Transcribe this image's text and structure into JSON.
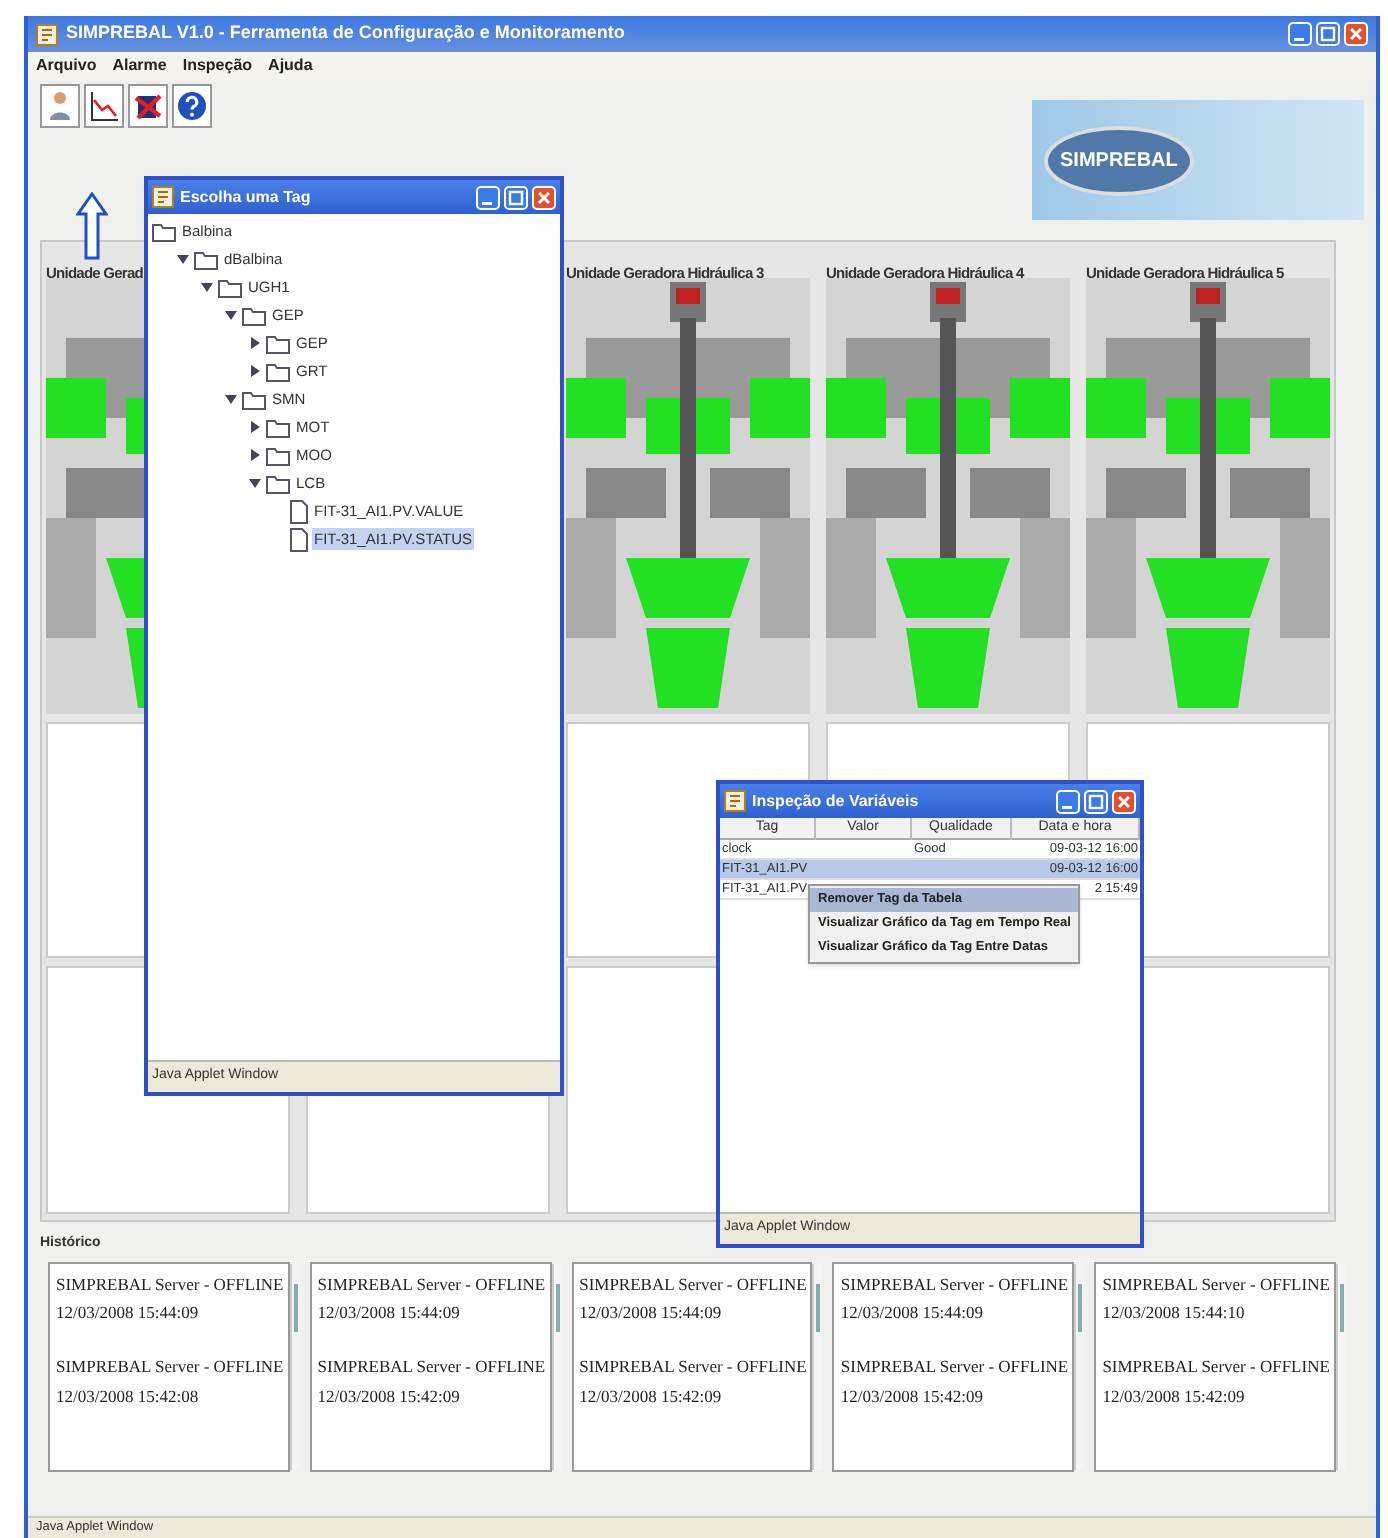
{
  "window": {
    "title": "SIMPREBAL V1.0 - Ferramenta de Configuração e Monitoramento"
  },
  "menu": [
    "Arquivo",
    "Alarme",
    "Inspeção",
    "Ajuda"
  ],
  "logo": {
    "text": "SIMPREBAL"
  },
  "units": [
    {
      "kind": "unit",
      "header": "Unidade Gerad"
    },
    {
      "kind": "unit"
    },
    {
      "kind": "unit",
      "header": "Unidade Geradora Hidráulica 3"
    },
    {
      "kind": "unit",
      "header": "Unidade Geradora Hidráulica 4"
    },
    {
      "kind": "unit",
      "header": "Unidade Geradora Hidráulica 5"
    }
  ],
  "history": {
    "label": "Histórico",
    "boxes": [
      {
        "entries": [
          {
            "message": "SIMPREBAL Server - OFFLINE",
            "time": "12/03/2008 15:44:09"
          },
          {
            "message": "SIMPREBAL Server - OFFLINE",
            "time": "12/03/2008 15:42:08"
          }
        ]
      },
      {
        "entries": [
          {
            "message": "SIMPREBAL Server - OFFLINE",
            "time": "12/03/2008 15:44:09"
          },
          {
            "message": "SIMPREBAL Server - OFFLINE",
            "time": "12/03/2008 15:42:09"
          }
        ]
      },
      {
        "entries": [
          {
            "message": "SIMPREBAL Server - OFFLINE",
            "time": "12/03/2008 15:44:09"
          },
          {
            "message": "SIMPREBAL Server - OFFLINE",
            "time": "12/03/2008 15:42:09"
          }
        ]
      },
      {
        "entries": [
          {
            "message": "SIMPREBAL Server - OFFLINE",
            "time": "12/03/2008 15:44:09"
          },
          {
            "message": "SIMPREBAL Server - OFFLINE",
            "time": "12/03/2008 15:42:09"
          }
        ]
      },
      {
        "entries": [
          {
            "message": "SIMPREBAL Server - OFFLINE",
            "time": "12/03/2008 15:44:10"
          },
          {
            "message": "SIMPREBAL Server - OFFLINE",
            "time": "12/03/2008 15:42:09"
          }
        ]
      }
    ]
  },
  "status_bar": "Java Applet Window",
  "tag_window": {
    "title": "Escolha uma Tag",
    "status_bar": "Java Applet Window",
    "tree": [
      {
        "label": "Balbina",
        "kind": "folder",
        "children": [
          {
            "label": "dBalbina",
            "kind": "folder",
            "expanded": true,
            "children": [
              {
                "label": "UGH1",
                "kind": "folder",
                "expanded": true,
                "children": [
                  {
                    "label": "GEP",
                    "kind": "folder",
                    "expanded": true,
                    "children": [
                      {
                        "label": "GEP",
                        "kind": "folder",
                        "expanded": false
                      },
                      {
                        "label": "GRT",
                        "kind": "folder",
                        "expanded": false
                      }
                    ]
                  },
                  {
                    "label": "SMN",
                    "kind": "folder",
                    "expanded": true,
                    "children": [
                      {
                        "label": "MOT",
                        "kind": "folder",
                        "expanded": false
                      },
                      {
                        "label": "MOO",
                        "kind": "folder",
                        "expanded": false
                      },
                      {
                        "label": "LCB",
                        "kind": "folder",
                        "expanded": true,
                        "children": [
                          {
                            "label": "FIT-31_AI1.PV.VALUE",
                            "kind": "file",
                            "selected": false
                          },
                          {
                            "label": "FIT-31_AI1.PV.STATUS",
                            "kind": "file",
                            "selected": true
                          }
                        ]
                      }
                    ]
                  }
                ]
              }
            ]
          }
        ]
      }
    ]
  },
  "inspect_window": {
    "title": "Inspeção de Variáveis",
    "status_bar": "Java Applet Window",
    "columns": [
      "Tag",
      "Valor",
      "Qualidade",
      "Data e hora"
    ],
    "rows": [
      {
        "cells": [
          "clock",
          "",
          "Good",
          "09-03-12 16:00"
        ],
        "selected": false
      },
      {
        "cells": [
          "FIT-31_AI1.PV",
          "",
          "",
          "09-03-12 16:00"
        ],
        "selected": true
      },
      {
        "cells": [
          "FIT-31_AI1.PV",
          "",
          "",
          "2 15:49"
        ],
        "selected": false
      }
    ],
    "context_menu": [
      {
        "label": "Remover Tag da Tabela",
        "selected": true
      },
      {
        "label": "Visualizar Gráfico da Tag em Tempo Real",
        "selected": false
      },
      {
        "label": "Visualizar Gráfico da Tag Entre Datas",
        "selected": false
      }
    ]
  }
}
